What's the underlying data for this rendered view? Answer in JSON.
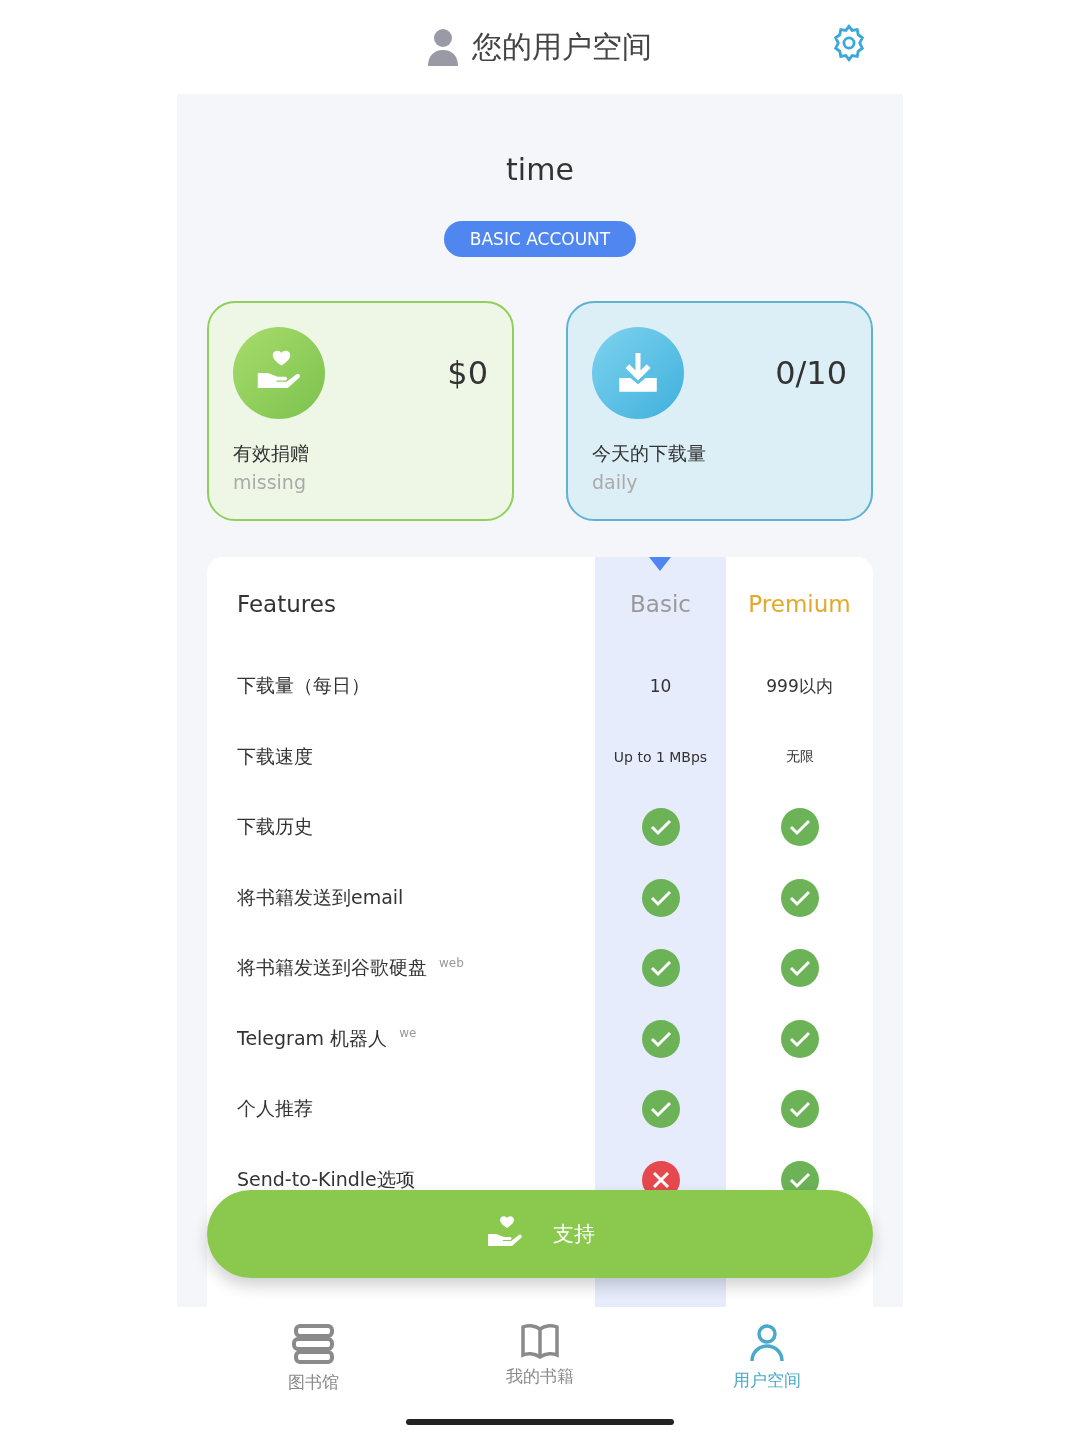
{
  "header": {
    "title": "您的用户空间"
  },
  "profile": {
    "name": "time",
    "badge": "BASIC ACCOUNT"
  },
  "stats": [
    {
      "kind": "donation",
      "value": "$0",
      "label": "有效捐赠",
      "sublabel": "missing"
    },
    {
      "kind": "downloads",
      "value": "0/10",
      "label": "今天的下载量",
      "sublabel": "daily"
    }
  ],
  "plans": {
    "heading": "Features",
    "columns": [
      {
        "name": "Basic",
        "selected": true
      },
      {
        "name": "Premium",
        "selected": false
      }
    ],
    "rows": [
      {
        "kind": "text",
        "feature": "下载量（每日）",
        "basic": "10",
        "premium": "999以内"
      },
      {
        "kind": "small",
        "feature": "下载速度",
        "basic": "Up to 1 MBps",
        "premium": "无限"
      },
      {
        "kind": "check",
        "feature": "下载历史",
        "basic": true,
        "premium": true
      },
      {
        "kind": "check",
        "feature": "将书籍发送到email",
        "basic": true,
        "premium": true
      },
      {
        "kind": "check",
        "feature": "将书籍发送到谷歌硬盘 $^{web}$",
        "basic": true,
        "premium": true
      },
      {
        "kind": "check",
        "feature": "Telegram 机器人 $^{we}$",
        "basic": true,
        "premium": true
      },
      {
        "kind": "check",
        "feature": "个人推荐",
        "basic": true,
        "premium": true
      },
      {
        "kind": "check",
        "feature": "Send-to-Kindle选项",
        "basic": false,
        "premium": true
      }
    ]
  },
  "support_button": "支持",
  "tabs": [
    {
      "kind": "library",
      "label": "图书馆",
      "selected": false
    },
    {
      "kind": "books",
      "label": "我的书籍",
      "selected": false
    },
    {
      "kind": "user",
      "label": "用户空间",
      "selected": true
    }
  ]
}
